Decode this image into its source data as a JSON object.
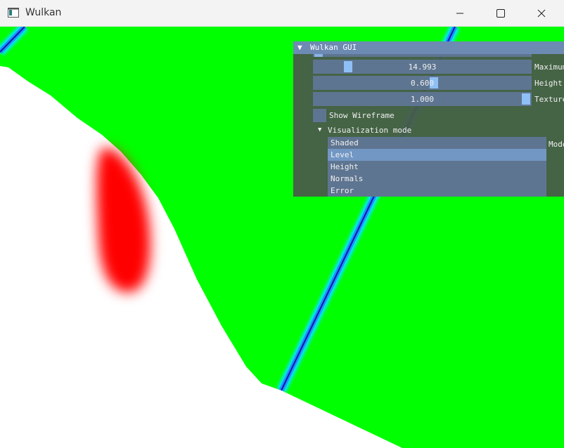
{
  "window": {
    "title": "Wulkan"
  },
  "gui": {
    "title": "Wulkan GUI",
    "sliders": [
      {
        "value_text": "14.993",
        "label": "Maximum",
        "fraction": 0.15
      },
      {
        "value_text": "0.600",
        "label": "Height",
        "fraction": 0.6
      },
      {
        "value_text": "1.000",
        "label": "Texture",
        "fraction": 1.0
      }
    ],
    "checkbox": {
      "label": "Show Wireframe",
      "checked": false
    },
    "tree": {
      "label": "Visualization mode",
      "expanded": true
    },
    "listbox": {
      "label": "Mode",
      "items": [
        "Shaded",
        "Level",
        "Height",
        "Normals",
        "Error"
      ],
      "selected": "Level"
    }
  },
  "colors": {
    "terrain_green": "#00ff00",
    "blob_red": "#ff0000",
    "line_blue": "#1e90ff",
    "gui_header": "#6d8ab2",
    "gui_bg": "#485d48",
    "frame_bg": "#5e7591",
    "slider_grab": "#8fc0f5",
    "selection": "#7297c5"
  },
  "icons": {
    "app": "window-icon",
    "minimize": "minimize-icon",
    "maximize": "maximize-icon",
    "close": "close-icon",
    "collapse": "triangle-down-icon"
  }
}
